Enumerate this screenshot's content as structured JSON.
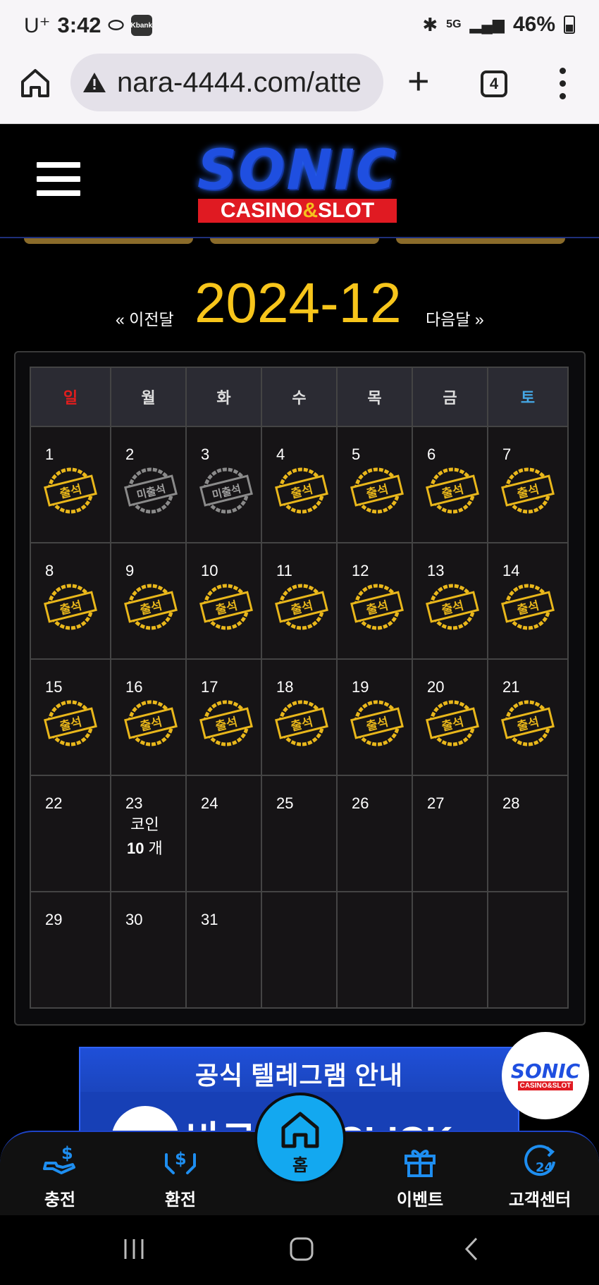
{
  "status_bar": {
    "carrier": "U⁺",
    "time": "3:42",
    "kbank_label": "Kbank",
    "network": "5G",
    "battery": "46%"
  },
  "browser": {
    "url": "nara-4444.com/atte",
    "tab_count": "4"
  },
  "site": {
    "logo_main": "SONIC",
    "logo_sub_left": "CASINO",
    "logo_sub_amp": "&",
    "logo_sub_right": "SLOT"
  },
  "calendar": {
    "prev_label": "« 이전달",
    "month": "2024-12",
    "next_label": "다음달 »",
    "weekdays": [
      "일",
      "월",
      "화",
      "수",
      "목",
      "금",
      "토"
    ],
    "attended_label": "출석",
    "absent_label": "미출석",
    "days": [
      {
        "n": "1",
        "stamp": "attended"
      },
      {
        "n": "2",
        "stamp": "absent"
      },
      {
        "n": "3",
        "stamp": "absent"
      },
      {
        "n": "4",
        "stamp": "attended"
      },
      {
        "n": "5",
        "stamp": "attended"
      },
      {
        "n": "6",
        "stamp": "attended"
      },
      {
        "n": "7",
        "stamp": "attended"
      },
      {
        "n": "8",
        "stamp": "attended"
      },
      {
        "n": "9",
        "stamp": "attended"
      },
      {
        "n": "10",
        "stamp": "attended"
      },
      {
        "n": "11",
        "stamp": "attended"
      },
      {
        "n": "12",
        "stamp": "attended"
      },
      {
        "n": "13",
        "stamp": "attended"
      },
      {
        "n": "14",
        "stamp": "attended"
      },
      {
        "n": "15",
        "stamp": "attended"
      },
      {
        "n": "16",
        "stamp": "attended"
      },
      {
        "n": "17",
        "stamp": "attended"
      },
      {
        "n": "18",
        "stamp": "attended"
      },
      {
        "n": "19",
        "stamp": "attended"
      },
      {
        "n": "20",
        "stamp": "attended"
      },
      {
        "n": "21",
        "stamp": "attended"
      },
      {
        "n": "22",
        "stamp": ""
      },
      {
        "n": "23",
        "stamp": "",
        "reward_label": "코인",
        "reward_amount": "10",
        "reward_unit": "개"
      },
      {
        "n": "24",
        "stamp": ""
      },
      {
        "n": "25",
        "stamp": ""
      },
      {
        "n": "26",
        "stamp": ""
      },
      {
        "n": "27",
        "stamp": ""
      },
      {
        "n": "28",
        "stamp": ""
      },
      {
        "n": "29",
        "stamp": ""
      },
      {
        "n": "30",
        "stamp": ""
      },
      {
        "n": "31",
        "stamp": ""
      },
      {
        "n": "",
        "stamp": ""
      },
      {
        "n": "",
        "stamp": ""
      },
      {
        "n": "",
        "stamp": ""
      },
      {
        "n": "",
        "stamp": ""
      }
    ]
  },
  "banner": {
    "title": "공식 텔레그램 안내",
    "cta": "바로가기 CLICK"
  },
  "badge": {
    "main": "SONIC",
    "sub": "CASINO&SLOT"
  },
  "bottom_nav": {
    "charge": "충전",
    "exchange": "환전",
    "home": "홈",
    "event": "이벤트",
    "support": "고객센터"
  },
  "colors": {
    "accent_gold": "#f7c51b",
    "sunday_red": "#e31d1d",
    "saturday_blue": "#45a8e6",
    "nav_blue": "#13a8f0"
  }
}
